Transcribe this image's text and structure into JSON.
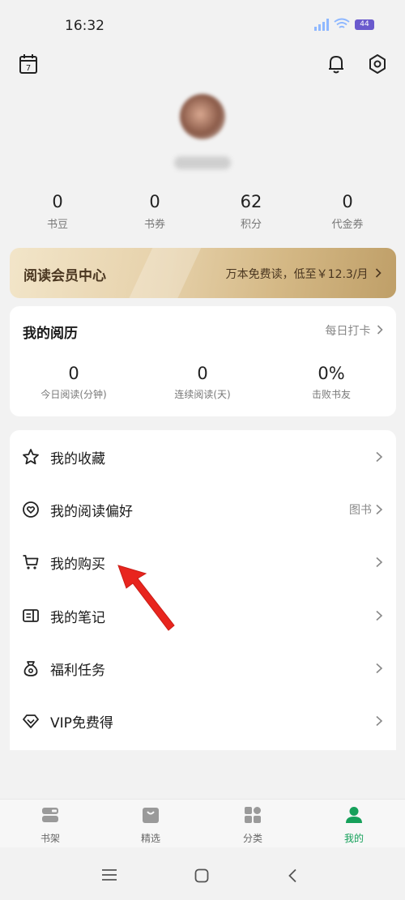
{
  "status_bar": {
    "time": "16:32",
    "battery": "44"
  },
  "stats": [
    {
      "value": "0",
      "label": "书豆"
    },
    {
      "value": "0",
      "label": "书券"
    },
    {
      "value": "62",
      "label": "积分"
    },
    {
      "value": "0",
      "label": "代金券"
    }
  ],
  "vip": {
    "title": "阅读会员中心",
    "offer": "万本免费读，低至￥12.3/月"
  },
  "history": {
    "title": "我的阅历",
    "checkin": "每日打卡",
    "stats": [
      {
        "value": "0",
        "label": "今日阅读(分钟)"
      },
      {
        "value": "0",
        "label": "连续阅读(天)"
      },
      {
        "value": "0%",
        "label": "击败书友"
      }
    ]
  },
  "menu": [
    {
      "label": "我的收藏",
      "icon": "star-icon"
    },
    {
      "label": "我的阅读偏好",
      "icon": "heart-icon",
      "extra": "图书"
    },
    {
      "label": "我的购买",
      "icon": "cart-icon"
    },
    {
      "label": "我的笔记",
      "icon": "note-icon"
    },
    {
      "label": "福利任务",
      "icon": "moneybag-icon"
    },
    {
      "label": "VIP免费得",
      "icon": "diamond-icon"
    }
  ],
  "tabs": [
    {
      "label": "书架",
      "icon": "bookshelf-icon"
    },
    {
      "label": "精选",
      "icon": "shopping-bag-icon"
    },
    {
      "label": "分类",
      "icon": "category-grid-icon"
    },
    {
      "label": "我的",
      "icon": "profile-icon",
      "active": true
    }
  ],
  "colors": {
    "accent": "#15a05a",
    "vip_text": "#4a3620",
    "annotation_arrow": "#e8251e"
  },
  "calendar_day": "7"
}
